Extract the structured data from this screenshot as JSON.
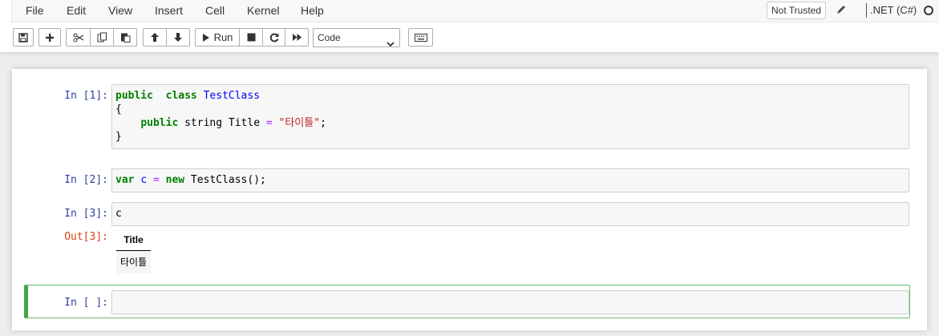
{
  "menu": [
    "File",
    "Edit",
    "View",
    "Insert",
    "Cell",
    "Kernel",
    "Help"
  ],
  "trust_label": "Not Trusted",
  "kernel": {
    "name": ".NET (C#)",
    "status": "idle"
  },
  "toolbar": {
    "run_label": "Run",
    "cell_type": "Code",
    "icons": [
      "save-icon",
      "plus-icon",
      "cut-icon",
      "copy-icon",
      "paste-icon",
      "arrow-up-icon",
      "arrow-down-icon",
      "play-icon",
      "stop-icon",
      "restart-icon",
      "fast-forward-icon",
      "keyboard-icon"
    ]
  },
  "cells": [
    {
      "prompt": "In [1]:",
      "code_lines": [
        [
          [
            "kw",
            "public"
          ],
          [
            "",
            "  "
          ],
          [
            "kw",
            "class"
          ],
          [
            "",
            " "
          ],
          [
            "def",
            "TestClass"
          ]
        ],
        [
          [
            "",
            "{"
          ]
        ],
        [
          [
            "",
            "    "
          ],
          [
            "kw",
            "public"
          ],
          [
            "",
            " string Title "
          ],
          [
            "op",
            "="
          ],
          [
            "",
            " "
          ],
          [
            "str",
            "\"타이틀\""
          ],
          [
            "",
            ";"
          ]
        ],
        [
          [
            "",
            "}"
          ]
        ]
      ]
    },
    {
      "prompt": "In [2]:",
      "code_lines": [
        [
          [
            "kw",
            "var"
          ],
          [
            "",
            " "
          ],
          [
            "def",
            "c"
          ],
          [
            "",
            " "
          ],
          [
            "op",
            "="
          ],
          [
            "",
            " "
          ],
          [
            "kw",
            "new"
          ],
          [
            "",
            " TestClass();"
          ]
        ]
      ]
    },
    {
      "prompt": "In [3]:",
      "code_lines": [
        [
          [
            "",
            "c"
          ]
        ]
      ],
      "output": {
        "prompt": "Out[3]:",
        "table": {
          "header": "Title",
          "value": "타이틀"
        }
      }
    },
    {
      "prompt": "In [ ]:",
      "code_lines": [],
      "selected": true
    }
  ],
  "colors": {
    "prompt_in": "#303f9f",
    "prompt_out": "#d84315",
    "keyword": "#008000",
    "definition": "#0000ff",
    "operator": "#aa22ff",
    "string": "#ba2121",
    "selected_border": "#42a545"
  }
}
